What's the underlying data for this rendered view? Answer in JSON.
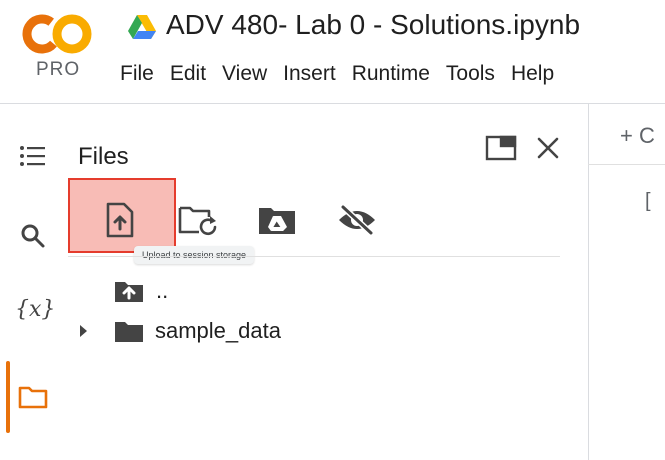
{
  "app": {
    "logo_text": "CO",
    "logo_badge": "PRO",
    "doc_title": "ADV 480- Lab 0 - Solutions.ipynb"
  },
  "menu": [
    "File",
    "Edit",
    "View",
    "Insert",
    "Runtime",
    "Tools",
    "Help"
  ],
  "rail": {
    "items": [
      {
        "icon": "table-of-contents-icon"
      },
      {
        "icon": "search-icon"
      },
      {
        "icon": "variables-icon",
        "label": "{x}"
      },
      {
        "icon": "folder-icon",
        "active": true
      }
    ]
  },
  "files_panel": {
    "title": "Files",
    "toolbar": [
      {
        "icon": "upload-file-icon",
        "tooltip": "Upload to session storage",
        "highlighted": true
      },
      {
        "icon": "refresh-folder-icon"
      },
      {
        "icon": "mount-drive-icon"
      },
      {
        "icon": "hide-icon"
      }
    ],
    "tree": [
      {
        "icon": "folder-up-icon",
        "label": ".."
      },
      {
        "icon": "folder-icon",
        "label": "sample_data",
        "expandable": true
      }
    ]
  },
  "editor": {
    "add_code_label": "+ C",
    "cell_bracket": "["
  },
  "colors": {
    "accent_orange": "#e8710a",
    "logo_orange": "#f9ab00",
    "highlight_fill": "#f8bcb6",
    "highlight_border": "#e53c2d"
  }
}
